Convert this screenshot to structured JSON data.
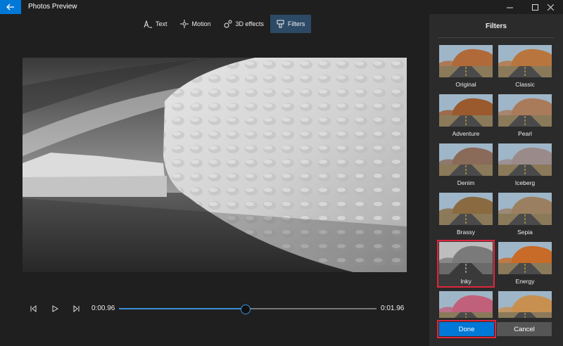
{
  "window": {
    "title": "Photos Preview"
  },
  "toolbar": {
    "text": "Text",
    "motion": "Motion",
    "effects3d": "3D effects",
    "filters": "Filters"
  },
  "player": {
    "current_time": "0:00.96",
    "total_time": "0:01.96",
    "progress": 0.49
  },
  "panel": {
    "title": "Filters",
    "filters": [
      {
        "name": "Original",
        "tint": "#b06a3a"
      },
      {
        "name": "Classic",
        "tint": "#b8763e"
      },
      {
        "name": "Adventure",
        "tint": "#9a5a2e"
      },
      {
        "name": "Pearl",
        "tint": "#a97b5a"
      },
      {
        "name": "Denim",
        "tint": "#8a6a58"
      },
      {
        "name": "Iceberg",
        "tint": "#9a8a8a"
      },
      {
        "name": "Brassy",
        "tint": "#8a6a40"
      },
      {
        "name": "Sepia",
        "tint": "#9a8060"
      },
      {
        "name": "Inky",
        "tint": "#7a7a7a"
      },
      {
        "name": "Energy",
        "tint": "#c86a28"
      },
      {
        "name": "",
        "tint": "#c0607a"
      },
      {
        "name": "",
        "tint": "#c89050"
      }
    ],
    "selected": "Inky",
    "done": "Done",
    "cancel": "Cancel"
  },
  "colors": {
    "accent": "#0078d7",
    "highlight": "#e0253c"
  }
}
